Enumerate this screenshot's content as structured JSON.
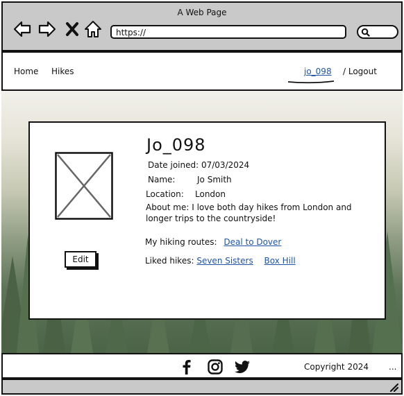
{
  "window": {
    "title": "A Web Page"
  },
  "browser": {
    "address": "https://",
    "icons": [
      "back-arrow-icon",
      "forward-arrow-icon",
      "close-x-icon",
      "home-icon",
      "search-icon"
    ]
  },
  "nav": {
    "home": "Home",
    "hikes": "Hikes",
    "user": "jo_098",
    "logout": "/ Logout"
  },
  "profile": {
    "username": "Jo_098",
    "date_joined_label": "Date joined:",
    "date_joined": "07/03/2024",
    "name_label": "Name:",
    "name": "Jo Smith",
    "location_label": "Location:",
    "location": "London",
    "about_line1": "About me: I love both day hikes from London and",
    "about_line2": "longer trips to the countryside!",
    "routes_label": "My hiking routes:",
    "routes": [
      "Deal to Dover"
    ],
    "liked_label": "Liked hikes:",
    "liked": [
      "Seven Sisters",
      "Box Hill"
    ],
    "edit_label": "Edit"
  },
  "footer": {
    "icons": [
      "facebook-icon",
      "instagram-icon",
      "twitter-icon"
    ],
    "copyright": "Copyright 2024",
    "more": "..."
  },
  "colors": {
    "chrome": "#c9c9c9",
    "link": "#1f55a5",
    "border": "#111111"
  }
}
